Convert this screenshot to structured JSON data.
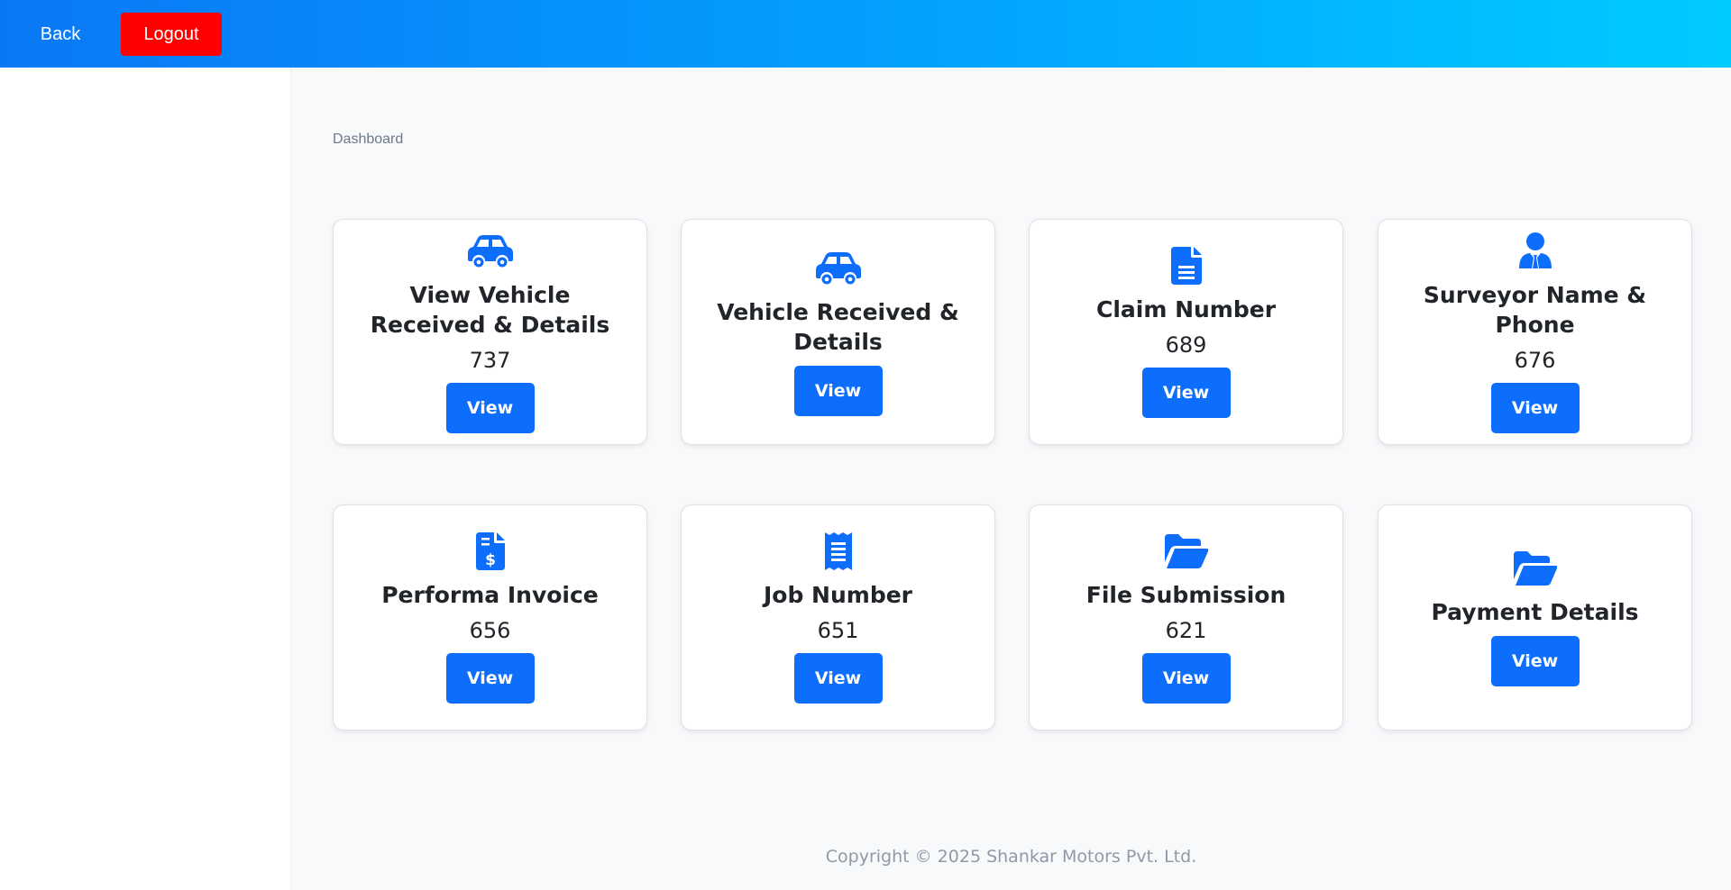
{
  "header": {
    "back_label": "Back",
    "logout_label": "Logout",
    "gradient_colors": [
      "#0a78f5",
      "#03a3ff",
      "#00cbff"
    ],
    "logout_color": "#ff0000"
  },
  "breadcrumb": "Dashboard",
  "accent_color": "#0d6efd",
  "cards": [
    {
      "icon": "car-icon",
      "title": "View Vehicle Received & Details",
      "count": "737",
      "button": "View"
    },
    {
      "icon": "car-icon",
      "title": "Vehicle Received & Details",
      "count": "",
      "button": "View"
    },
    {
      "icon": "document-icon",
      "title": "Claim Number",
      "count": "689",
      "button": "View"
    },
    {
      "icon": "user-tie-icon",
      "title": "Surveyor Name & Phone",
      "count": "676",
      "button": "View"
    },
    {
      "icon": "invoice-dollar-icon",
      "title": "Performa Invoice",
      "count": "656",
      "button": "View"
    },
    {
      "icon": "receipt-icon",
      "title": "Job Number",
      "count": "651",
      "button": "View"
    },
    {
      "icon": "folder-open-icon",
      "title": "File Submission",
      "count": "621",
      "button": "View"
    },
    {
      "icon": "folder-open-icon",
      "title": "Payment Details",
      "count": "",
      "button": "View"
    }
  ],
  "footer": "Copyright © 2025 Shankar Motors Pvt. Ltd."
}
